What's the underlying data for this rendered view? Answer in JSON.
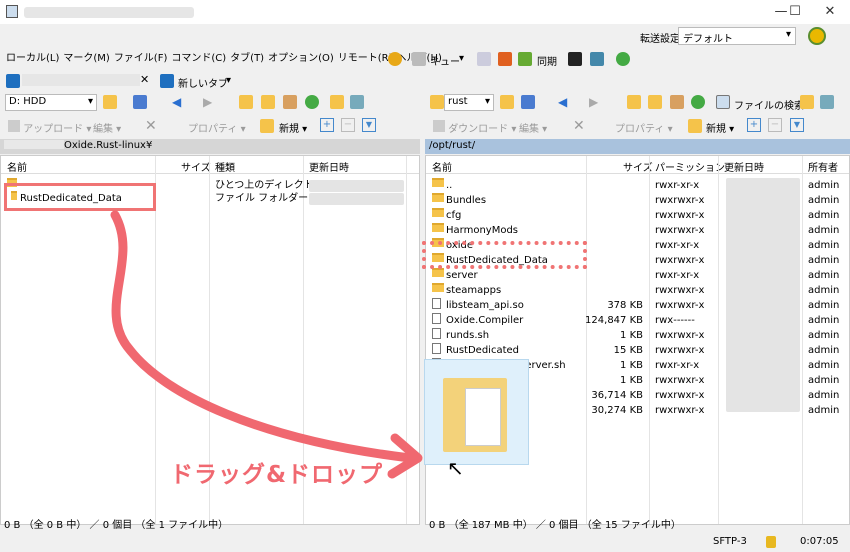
{
  "window": {
    "minimize": "—",
    "maximize": "☐",
    "close": "✕"
  },
  "profile": {
    "label": "転送設定",
    "value": "デフォルト"
  },
  "menu": [
    "ローカル(L)",
    "マーク(M)",
    "ファイル(F)",
    "コマンド(C)",
    "タブ(T)",
    "オプション(O)",
    "リモート(R)",
    "ヘルプ(H)"
  ],
  "toolbar": {
    "queue": "キュー",
    "sync": "同期"
  },
  "tabs": {
    "new_tab": "新しいタブ"
  },
  "left": {
    "drive": "D: HDD",
    "toolbar": {
      "upload": "アップロード",
      "edit": "編集",
      "properties": "プロパティ",
      "new": "新規"
    },
    "path": "Oxide.Rust-linux¥",
    "columns": {
      "name": "名前",
      "size": "サイズ",
      "type": "種類",
      "modified": "更新日時"
    },
    "rows": [
      {
        "name": "",
        "type": "ひとつ上のディレクトリ"
      },
      {
        "name": "RustDedicated_Data",
        "type": "ファイル フォルダー"
      }
    ],
    "status": "0 B （全 0 B 中） ／ 0 個目 （全 1 ファイル中）"
  },
  "right": {
    "drive": "rust",
    "search": "ファイルの検索",
    "toolbar": {
      "download": "ダウンロード",
      "edit": "編集",
      "properties": "プロパティ",
      "new": "新規"
    },
    "path": "/opt/rust/",
    "columns": {
      "name": "名前",
      "size": "サイズ",
      "perm": "パーミッション",
      "modified": "更新日時",
      "owner": "所有者"
    },
    "rows": [
      {
        "name": "..",
        "size": "",
        "perm": "rwxr-xr-x",
        "owner": "admin",
        "kind": "up"
      },
      {
        "name": "Bundles",
        "size": "",
        "perm": "rwxrwxr-x",
        "owner": "admin",
        "kind": "folder"
      },
      {
        "name": "cfg",
        "size": "",
        "perm": "rwxrwxr-x",
        "owner": "admin",
        "kind": "folder"
      },
      {
        "name": "HarmonyMods",
        "size": "",
        "perm": "rwxrwxr-x",
        "owner": "admin",
        "kind": "folder"
      },
      {
        "name": "oxide",
        "size": "",
        "perm": "rwxr-xr-x",
        "owner": "admin",
        "kind": "folder"
      },
      {
        "name": "RustDedicated_Data",
        "size": "",
        "perm": "rwxrwxr-x",
        "owner": "admin",
        "kind": "folder"
      },
      {
        "name": "server",
        "size": "",
        "perm": "rwxr-xr-x",
        "owner": "admin",
        "kind": "folder"
      },
      {
        "name": "steamapps",
        "size": "",
        "perm": "rwxrwxr-x",
        "owner": "admin",
        "kind": "folder"
      },
      {
        "name": "libsteam_api.so",
        "size": "378 KB",
        "perm": "rwxrwxr-x",
        "owner": "admin",
        "kind": "file"
      },
      {
        "name": "Oxide.Compiler",
        "size": "124,847 KB",
        "perm": "rwx------",
        "owner": "admin",
        "kind": "file"
      },
      {
        "name": "runds.sh",
        "size": "1 KB",
        "perm": "rwxrwxr-x",
        "owner": "admin",
        "kind": "file"
      },
      {
        "name": "RustDedicated",
        "size": "15 KB",
        "perm": "rwxrwxr-x",
        "owner": "admin",
        "kind": "file"
      },
      {
        "name": "RustDedicatedServer.sh",
        "size": "1 KB",
        "perm": "rwxr-xr-x",
        "owner": "admin",
        "kind": "file"
      },
      {
        "name": "",
        "size": "1 KB",
        "perm": "rwxrwxr-x",
        "owner": "admin",
        "kind": "file"
      },
      {
        "name": "",
        "size": "36,714 KB",
        "perm": "rwxrwxr-x",
        "owner": "admin",
        "kind": "file"
      },
      {
        "name": "",
        "size": "30,274 KB",
        "perm": "rwxrwxr-x",
        "owner": "admin",
        "kind": "file"
      }
    ],
    "status": "0 B （全 187 MB 中） ／ 0 個目 （全 15 ファイル中）"
  },
  "bottom": {
    "protocol": "SFTP-3",
    "time": "0:07:05"
  },
  "annotation": {
    "drag_text": "ドラッグ&ドロップ"
  },
  "colors": {
    "highlight": "#f07474",
    "pathbar": "#a9c2dd",
    "selection": "#cce4f7"
  }
}
